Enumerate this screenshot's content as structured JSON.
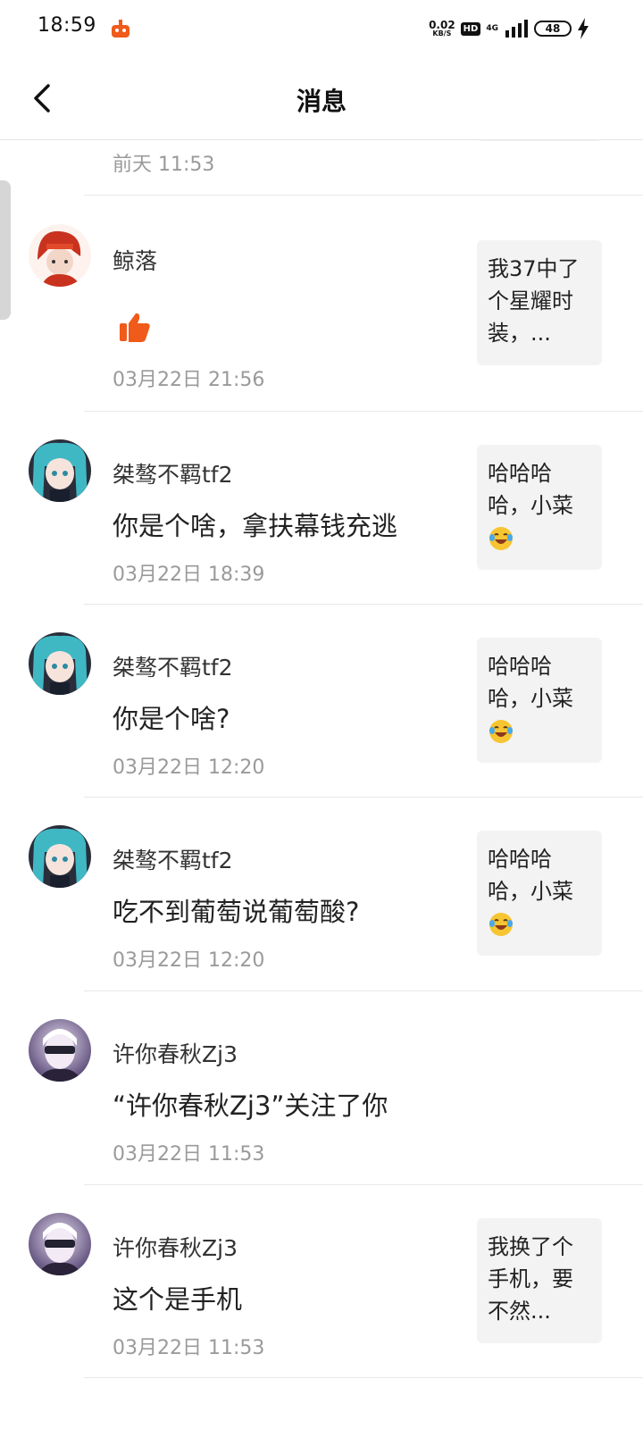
{
  "status": {
    "time": "18:59",
    "net_speed": "0.02",
    "net_unit": "KB/S",
    "hd": "HD",
    "network": "4G",
    "battery": "48"
  },
  "header": {
    "title": "消息",
    "back_icon": "chevron-left-icon"
  },
  "partial_row": {
    "time": "前天 11:53"
  },
  "messages": [
    {
      "username": "鲸落",
      "content_icon": "thumbs-up-icon",
      "time": "03月22日 21:56",
      "ref": "我37中了个星耀时装，...",
      "avatar_colors": [
        "#c8321e",
        "#f2d6c8"
      ]
    },
    {
      "username": "桀骜不羁tf2",
      "text": "你是个啥，拿扶幕钱充逃",
      "time": "03月22日 18:39",
      "ref": "哈哈哈哈，小菜",
      "ref_emoji": "laughing-tears-emoji-icon",
      "avatar_colors": [
        "#3fb8c4",
        "#1a1f2e"
      ]
    },
    {
      "username": "桀骜不羁tf2",
      "text": "你是个啥?",
      "time": "03月22日 12:20",
      "ref": "哈哈哈哈，小菜",
      "ref_emoji": "laughing-tears-emoji-icon",
      "avatar_colors": [
        "#3fb8c4",
        "#1a1f2e"
      ]
    },
    {
      "username": "桀骜不羁tf2",
      "text": "吃不到葡萄说葡萄酸?",
      "time": "03月22日 12:20",
      "ref": "哈哈哈哈，小菜",
      "ref_emoji": "laughing-tears-emoji-icon",
      "avatar_colors": [
        "#3fb8c4",
        "#1a1f2e"
      ]
    },
    {
      "username": "许你春秋Zj3",
      "text": "“许你春秋Zj3”关注了你",
      "time": "03月22日 11:53",
      "avatar_colors": [
        "#5a4a78",
        "#e8dff0"
      ]
    },
    {
      "username": "许你春秋Zj3",
      "text": "这个是手机",
      "time": "03月22日 11:53",
      "ref": " 我换了个手机，要不然...",
      "avatar_colors": [
        "#5a4a78",
        "#e8dff0"
      ]
    }
  ],
  "colors": {
    "accent_orange": "#f05a1a",
    "divider": "#e8e8e8",
    "muted_text": "#9a9a9a",
    "card_bg": "#f3f3f3"
  }
}
